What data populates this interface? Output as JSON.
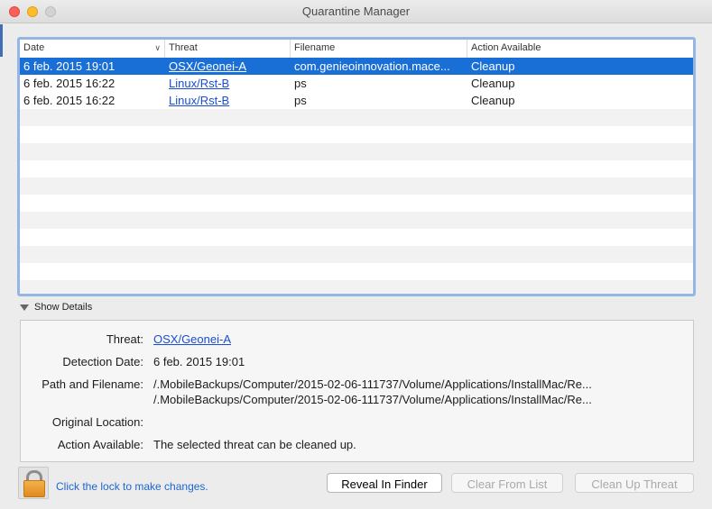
{
  "window": {
    "title": "Quarantine Manager"
  },
  "table": {
    "columns": [
      "Date",
      "Threat",
      "Filename",
      "Action Available"
    ],
    "rows": [
      {
        "date": "6 feb. 2015 19:01",
        "threat": "OSX/Geonei-A",
        "filename": "com.genieoinnovation.mace...",
        "action": "Cleanup"
      },
      {
        "date": "6 feb. 2015 16:22",
        "threat": "Linux/Rst-B",
        "filename": "ps",
        "action": "Cleanup"
      },
      {
        "date": "6 feb. 2015 16:22",
        "threat": "Linux/Rst-B",
        "filename": "ps",
        "action": "Cleanup"
      }
    ],
    "selected_row": 0
  },
  "details": {
    "toggle_label": "Show Details",
    "threat_label": "Threat:",
    "threat_value": "OSX/Geonei-A",
    "detection_label": "Detection Date:",
    "detection_value": "6 feb. 2015 19:01",
    "path_label": "Path and Filename:",
    "path_line1": "/.MobileBackups/Computer/2015-02-06-111737/Volume/Applications/InstallMac/Re...",
    "path_line2": "/.MobileBackups/Computer/2015-02-06-111737/Volume/Applications/InstallMac/Re...",
    "original_location_label": "Original Location:",
    "action_label": "Action Available:",
    "action_value": "The selected threat can be cleaned up."
  },
  "footer": {
    "lock_text": "Click the lock to make changes.",
    "reveal_button": "Reveal In Finder",
    "clear_button": "Clear From List",
    "cleanup_button": "Clean Up Threat"
  },
  "colors": {
    "selection": "#1a6fd6",
    "link": "#1a4ed1",
    "table_border": "#93b6e4"
  },
  "icons": [
    "close-icon",
    "minimize-icon",
    "zoom-icon",
    "sort-descending-icon",
    "disclosure-triangle-icon",
    "lock-icon"
  ]
}
